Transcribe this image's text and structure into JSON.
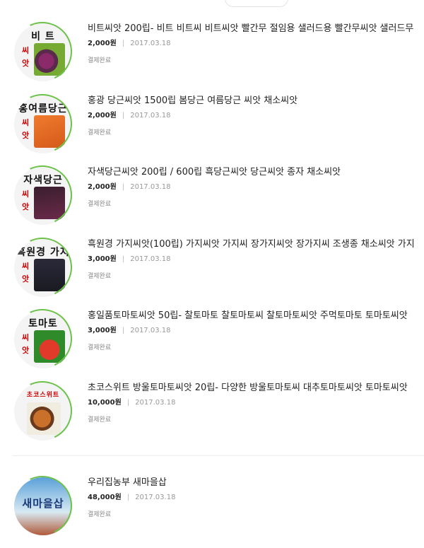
{
  "orders": [
    {
      "package_text": "비  트",
      "side_text": "씨\n앗",
      "title": "비트씨앗 200립- 비트 비트씨 비트씨앗 빨간무 절임용 샐러드용 빨간무씨앗 샐러드무",
      "price": "2,000원",
      "date": "2017.03.18",
      "status": "결제완료"
    },
    {
      "package_text": "홍여름당근",
      "side_text": "씨\n앗",
      "title": "홍광 당근씨앗 1500립 봄당근 여름당근 씨앗 채소씨앗",
      "price": "2,000원",
      "date": "2017.03.18",
      "status": "결제완료"
    },
    {
      "package_text": "자색당근",
      "side_text": "씨\n앗",
      "title": "자색당근씨앗 200립 / 600립 흑당근씨앗 당근씨앗 종자 채소씨앗",
      "price": "2,000원",
      "date": "2017.03.18",
      "status": "결제완료"
    },
    {
      "package_text": "흑원경 가지",
      "side_text": "씨\n앗",
      "title": "흑원경 가지씨앗(100립) 가지씨앗 가지씨 장가지씨앗 장가지씨 조생종 채소씨앗 가지",
      "price": "3,000원",
      "date": "2017.03.18",
      "status": "결제완료"
    },
    {
      "package_text": "토마토",
      "side_text": "씨\n앗",
      "title": "홍일품토마토씨앗 50립- 찰토마토 찰토마토씨 찰토마토씨앗 주먹토마토 토마토씨앗",
      "price": "3,000원",
      "date": "2017.03.18",
      "status": "결제완료"
    },
    {
      "package_text": "초코스위트",
      "side_text": "",
      "title": "초코스위트 방울토마토씨앗 20립- 다양한 방울토마토씨 대추토마토씨앗 토마토씨앗",
      "price": "10,000원",
      "date": "2017.03.18",
      "status": "결제완료"
    },
    {
      "package_text": "새마을삽",
      "side_text": "",
      "title": "우리집농부 새마을삽",
      "price": "48,000원",
      "date": "2017.03.18",
      "status": "결제완료"
    }
  ],
  "colors": {
    "ring_accent": "#6cc24a",
    "divider": "#ededed",
    "muted_text": "#999999"
  }
}
